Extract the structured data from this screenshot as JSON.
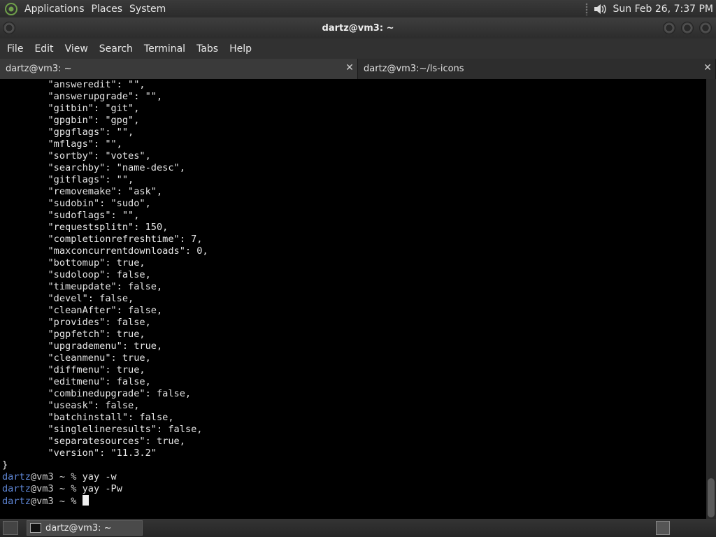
{
  "top_panel": {
    "menus": [
      "Applications",
      "Places",
      "System"
    ],
    "clock": "Sun Feb 26,  7:37 PM"
  },
  "window": {
    "title": "dartz@vm3: ~"
  },
  "menubar": [
    "File",
    "Edit",
    "View",
    "Search",
    "Terminal",
    "Tabs",
    "Help"
  ],
  "tabs": [
    {
      "label": "dartz@vm3: ~",
      "active": true
    },
    {
      "label": "dartz@vm3:~/ls-icons",
      "active": false
    }
  ],
  "terminal": {
    "lines": [
      "        \"answeredit\": \"\",",
      "        \"answerupgrade\": \"\",",
      "        \"gitbin\": \"git\",",
      "        \"gpgbin\": \"gpg\",",
      "        \"gpgflags\": \"\",",
      "        \"mflags\": \"\",",
      "        \"sortby\": \"votes\",",
      "        \"searchby\": \"name-desc\",",
      "        \"gitflags\": \"\",",
      "        \"removemake\": \"ask\",",
      "        \"sudobin\": \"sudo\",",
      "        \"sudoflags\": \"\",",
      "        \"requestsplitn\": 150,",
      "        \"completionrefreshtime\": 7,",
      "        \"maxconcurrentdownloads\": 0,",
      "        \"bottomup\": true,",
      "        \"sudoloop\": false,",
      "        \"timeupdate\": false,",
      "        \"devel\": false,",
      "        \"cleanAfter\": false,",
      "        \"provides\": false,",
      "        \"pgpfetch\": true,",
      "        \"upgrademenu\": true,",
      "        \"cleanmenu\": true,",
      "        \"diffmenu\": true,",
      "        \"editmenu\": false,",
      "        \"combinedupgrade\": false,",
      "        \"useask\": false,",
      "        \"batchinstall\": false,",
      "        \"singlelineresults\": false,",
      "        \"separatesources\": true,",
      "        \"version\": \"11.3.2\"",
      "}"
    ],
    "prompts": [
      {
        "user": "dartz",
        "host": "@vm3 ~ % ",
        "cmd": "yay -w"
      },
      {
        "user": "dartz",
        "host": "@vm3 ~ % ",
        "cmd": "yay -Pw"
      },
      {
        "user": "dartz",
        "host": "@vm3 ~ % ",
        "cmd": ""
      }
    ]
  },
  "bottom_panel": {
    "task_label": "dartz@vm3: ~"
  }
}
